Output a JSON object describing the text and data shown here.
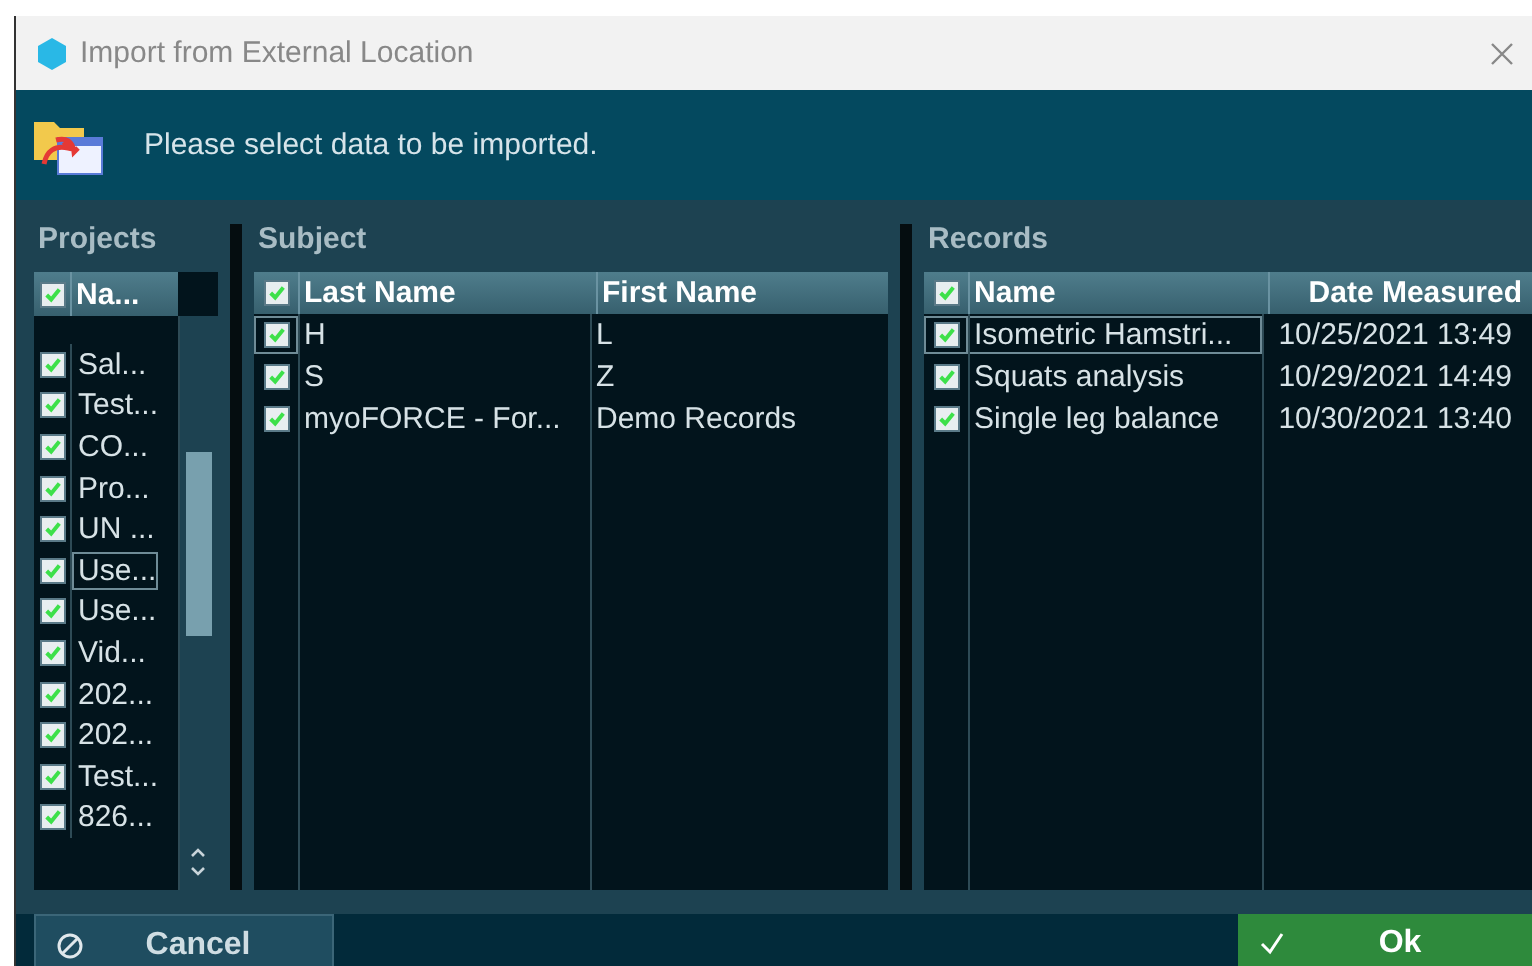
{
  "window": {
    "title": "Import from External Location"
  },
  "banner": {
    "message": "Please select data to be imported."
  },
  "projects": {
    "title": "Projects",
    "header": {
      "label": "Na...",
      "checked": true
    },
    "rows": [
      {
        "name": "Sal...",
        "checked": true,
        "focused": false
      },
      {
        "name": "Test...",
        "checked": true,
        "focused": false
      },
      {
        "name": "CO...",
        "checked": true,
        "focused": false
      },
      {
        "name": "Pro...",
        "checked": true,
        "focused": false
      },
      {
        "name": "UN ...",
        "checked": true,
        "focused": false
      },
      {
        "name": "Use...",
        "checked": true,
        "focused": true
      },
      {
        "name": "Use...",
        "checked": true,
        "focused": false
      },
      {
        "name": "Vid...",
        "checked": true,
        "focused": false
      },
      {
        "name": "202...",
        "checked": true,
        "focused": false
      },
      {
        "name": "202...",
        "checked": true,
        "focused": false
      },
      {
        "name": "Test...",
        "checked": true,
        "focused": false
      },
      {
        "name": "826...",
        "checked": true,
        "focused": false
      }
    ]
  },
  "subject": {
    "title": "Subject",
    "header_checked": true,
    "columns": [
      "Last Name",
      "First Name"
    ],
    "rows": [
      {
        "cells": [
          "H",
          "L"
        ],
        "checked": true,
        "focused": true
      },
      {
        "cells": [
          "S",
          "Z"
        ],
        "checked": true,
        "focused": false
      },
      {
        "cells": [
          "myoFORCE - For...",
          "Demo Records"
        ],
        "checked": true,
        "focused": false
      }
    ]
  },
  "records": {
    "title": "Records",
    "header_checked": true,
    "columns": [
      "Name",
      "Date Measured"
    ],
    "rows": [
      {
        "cells": [
          "Isometric Hamstri...",
          "10/25/2021 13:49"
        ],
        "checked": true,
        "focused": true
      },
      {
        "cells": [
          "Squats analysis",
          "10/29/2021 14:49"
        ],
        "checked": true,
        "focused": false
      },
      {
        "cells": [
          "Single leg balance",
          "10/30/2021 13:40"
        ],
        "checked": true,
        "focused": false
      }
    ]
  },
  "buttons": {
    "cancel": "Cancel",
    "ok": "Ok"
  }
}
